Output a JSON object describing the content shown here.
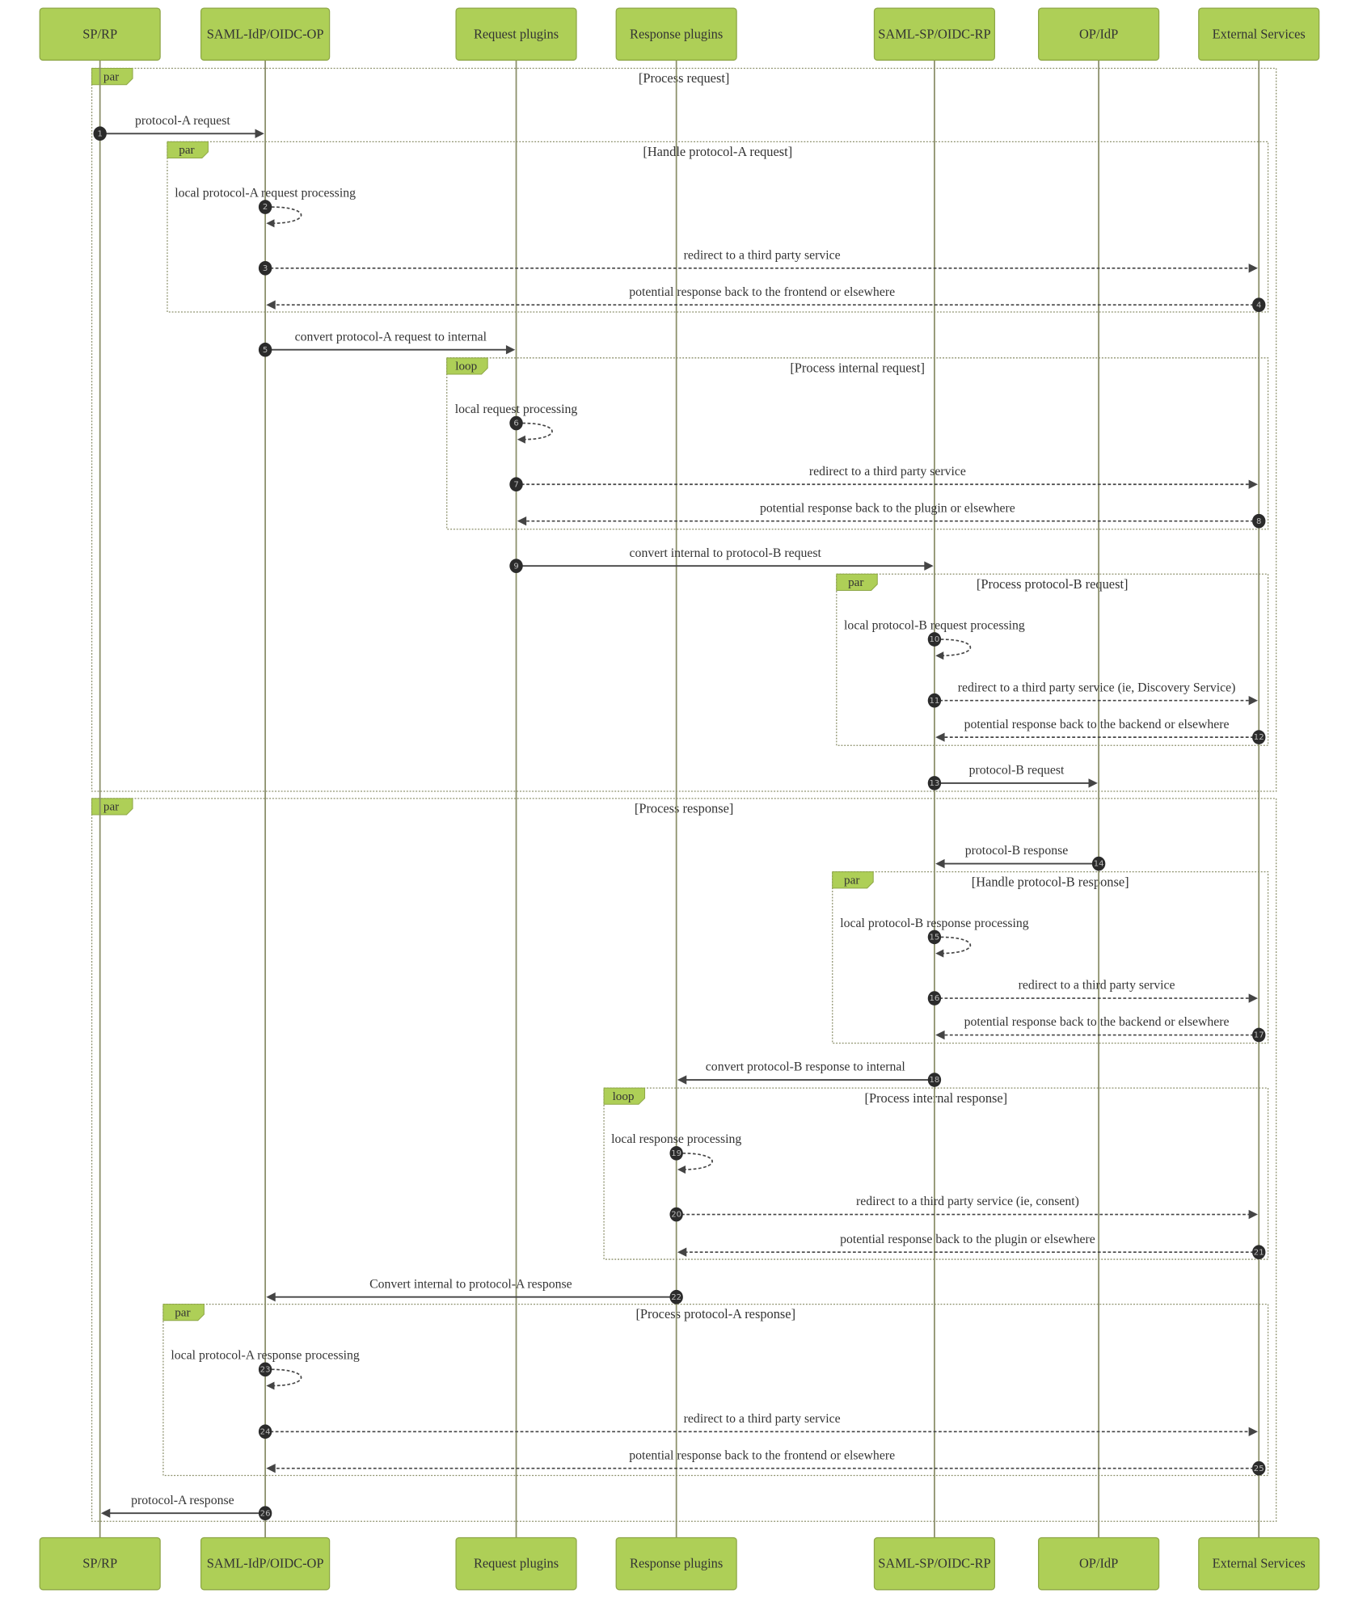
{
  "diagram": {
    "type": "sequence",
    "participants": [
      {
        "id": "sp",
        "label": "SP/RP"
      },
      {
        "id": "idp",
        "label": "SAML-IdP/OIDC-OP"
      },
      {
        "id": "reqp",
        "label": "Request plugins"
      },
      {
        "id": "resp",
        "label": "Response plugins"
      },
      {
        "id": "spb",
        "label": "SAML-SP/OIDC-RP"
      },
      {
        "id": "op",
        "label": "OP/IdP"
      },
      {
        "id": "ext",
        "label": "External Services"
      }
    ],
    "frames": [
      {
        "kind": "par",
        "title": "[Process request]"
      },
      {
        "kind": "par",
        "title": "[Handle protocol-A request]"
      },
      {
        "kind": "loop",
        "title": "[Process internal request]"
      },
      {
        "kind": "par",
        "title": "[Process protocol-B request]"
      },
      {
        "kind": "par",
        "title": "[Process response]"
      },
      {
        "kind": "par",
        "title": "[Handle protocol-B response]"
      },
      {
        "kind": "loop",
        "title": "[Process internal response]"
      },
      {
        "kind": "par",
        "title": "[Process protocol-A response]"
      }
    ],
    "messages": [
      {
        "n": "1",
        "from": "sp",
        "to": "idp",
        "style": "solid",
        "text": "protocol-A request"
      },
      {
        "n": "2",
        "from": "idp",
        "to": "idp",
        "style": "self",
        "text": "local protocol-A request processing"
      },
      {
        "n": "3",
        "from": "idp",
        "to": "ext",
        "style": "dashed",
        "text": "redirect to a third party service"
      },
      {
        "n": "4",
        "from": "ext",
        "to": "idp",
        "style": "dashed",
        "text": "potential response back to the frontend or elsewhere"
      },
      {
        "n": "5",
        "from": "idp",
        "to": "reqp",
        "style": "solid",
        "text": "convert protocol-A request to internal"
      },
      {
        "n": "6",
        "from": "reqp",
        "to": "reqp",
        "style": "self",
        "text": "local request processing"
      },
      {
        "n": "7",
        "from": "reqp",
        "to": "ext",
        "style": "dashed",
        "text": "redirect to a third party service"
      },
      {
        "n": "8",
        "from": "ext",
        "to": "reqp",
        "style": "dashed",
        "text": "potential response back to the plugin or elsewhere"
      },
      {
        "n": "9",
        "from": "reqp",
        "to": "spb",
        "style": "solid",
        "text": "convert internal to protocol-B request"
      },
      {
        "n": "10",
        "from": "spb",
        "to": "spb",
        "style": "self",
        "text": "local protocol-B request processing"
      },
      {
        "n": "11",
        "from": "spb",
        "to": "ext",
        "style": "dashed",
        "text": "redirect to a third party service (ie, Discovery Service)"
      },
      {
        "n": "12",
        "from": "ext",
        "to": "spb",
        "style": "dashed",
        "text": "potential response back to the backend or elsewhere"
      },
      {
        "n": "13",
        "from": "spb",
        "to": "op",
        "style": "solid",
        "text": "protocol-B request"
      },
      {
        "n": "14",
        "from": "op",
        "to": "spb",
        "style": "solid",
        "text": "protocol-B response"
      },
      {
        "n": "15",
        "from": "spb",
        "to": "spb",
        "style": "self",
        "text": "local protocol-B response processing"
      },
      {
        "n": "16",
        "from": "spb",
        "to": "ext",
        "style": "dashed",
        "text": "redirect to a third party service"
      },
      {
        "n": "17",
        "from": "ext",
        "to": "spb",
        "style": "dashed",
        "text": "potential response back to the backend or elsewhere"
      },
      {
        "n": "18",
        "from": "spb",
        "to": "resp",
        "style": "solid",
        "text": "convert protocol-B response to internal"
      },
      {
        "n": "19",
        "from": "resp",
        "to": "resp",
        "style": "self",
        "text": "local response processing"
      },
      {
        "n": "20",
        "from": "resp",
        "to": "ext",
        "style": "dashed",
        "text": "redirect to a third party service (ie, consent)"
      },
      {
        "n": "21",
        "from": "ext",
        "to": "resp",
        "style": "dashed",
        "text": "potential response back to the plugin or elsewhere"
      },
      {
        "n": "22",
        "from": "resp",
        "to": "idp",
        "style": "solid",
        "text": "Convert internal to protocol-A response"
      },
      {
        "n": "23",
        "from": "idp",
        "to": "idp",
        "style": "self",
        "text": "local protocol-A response processing"
      },
      {
        "n": "24",
        "from": "idp",
        "to": "ext",
        "style": "dashed",
        "text": "redirect to a third party service"
      },
      {
        "n": "25",
        "from": "ext",
        "to": "idp",
        "style": "dashed",
        "text": "potential response back to the frontend or elsewhere"
      },
      {
        "n": "26",
        "from": "idp",
        "to": "sp",
        "style": "solid",
        "text": "protocol-A response"
      }
    ]
  }
}
